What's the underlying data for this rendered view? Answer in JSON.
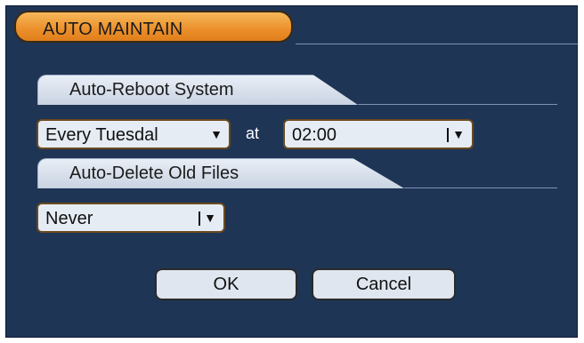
{
  "dialog": {
    "title": "AUTO MAINTAIN"
  },
  "auto_reboot": {
    "section_label": "Auto-Reboot System",
    "day_select_value": "Every Tuesdal",
    "at_label": "at",
    "time_select_value": "02:00"
  },
  "auto_delete": {
    "section_label": "Auto-Delete Old Files",
    "select_value": "Never"
  },
  "buttons": {
    "ok_label": "OK",
    "cancel_label": "Cancel"
  },
  "colors": {
    "panel_background": "#1f3556",
    "title_tab": "#eb8f2a",
    "section_tab": "#d9e1ec",
    "control_background": "#e6ecf4",
    "control_border": "#6b4a1f"
  }
}
